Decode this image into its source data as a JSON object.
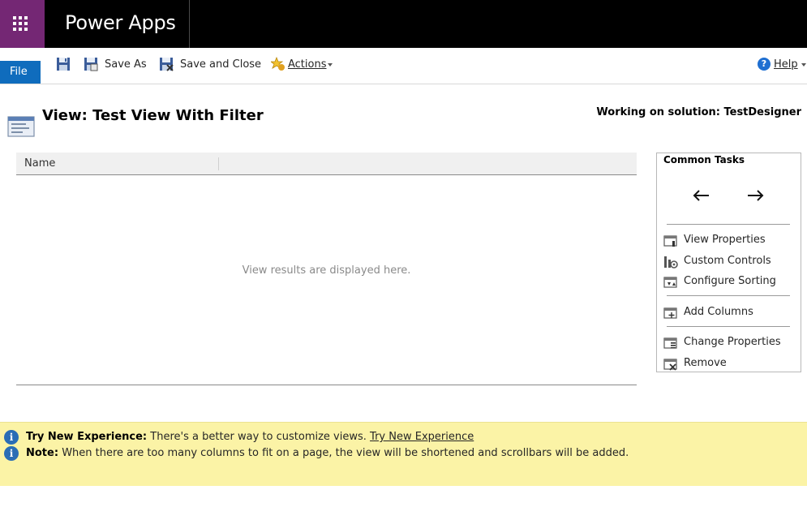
{
  "header": {
    "app_title": "Power Apps"
  },
  "commandbar": {
    "file": "File",
    "save_as": "Save As",
    "save_and_close": "Save and Close",
    "actions": "Actions",
    "help": "Help"
  },
  "page": {
    "title": "View: Test View With Filter",
    "working_on": "Working on solution: TestDesigner"
  },
  "grid": {
    "columns": [
      "Name"
    ],
    "empty_message": "View results are displayed here."
  },
  "common_tasks": {
    "title": "Common Tasks",
    "items": [
      {
        "label": "View Properties",
        "icon": "view-properties-icon"
      },
      {
        "label": "Custom Controls",
        "icon": "custom-controls-icon"
      },
      {
        "label": "Configure Sorting",
        "icon": "configure-sorting-icon"
      },
      {
        "label": "Add Columns",
        "icon": "add-columns-icon"
      },
      {
        "label": "Change Properties",
        "icon": "change-properties-icon"
      },
      {
        "label": "Remove",
        "icon": "remove-icon"
      }
    ]
  },
  "banner": {
    "try_label": "Try New Experience:",
    "try_text": "There's a better way to customize views.",
    "try_link": "Try New Experience",
    "note_label": "Note:",
    "note_text": "When there are too many columns to fit on a page, the view will be shortened and scrollbars will be added."
  },
  "colors": {
    "topbar": "#000000",
    "waffle": "#742774",
    "file_button": "#0f6cbd",
    "banner": "#fbf3a6",
    "info_icon": "#2a6db5"
  }
}
